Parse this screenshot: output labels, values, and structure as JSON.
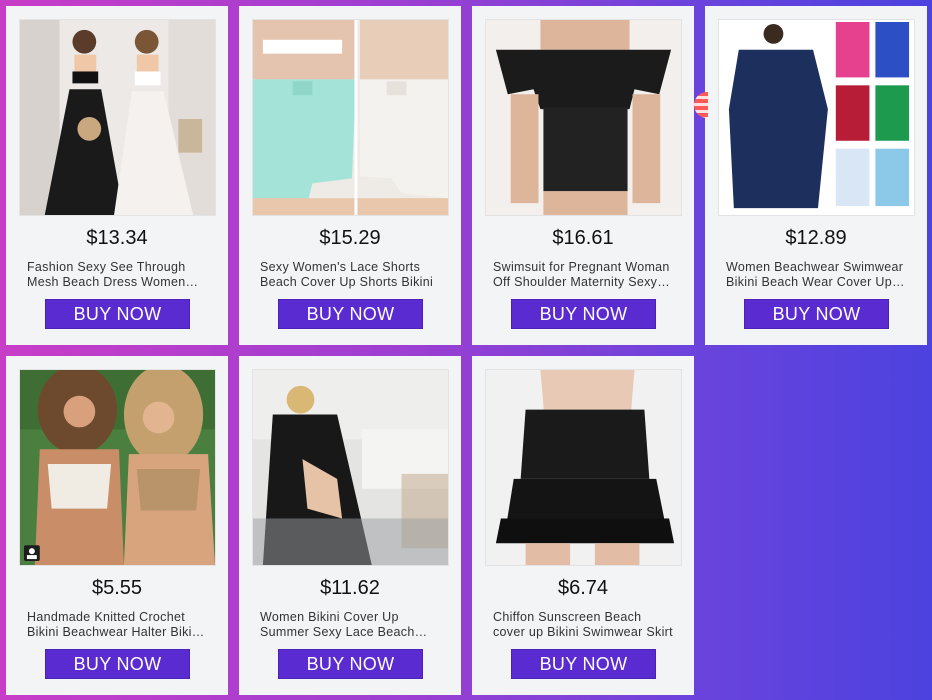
{
  "products": [
    {
      "price": "$13.34",
      "title": "Fashion Sexy See Through Mesh Beach Dress Women Cover Up",
      "buy_label": "BUY NOW"
    },
    {
      "price": "$15.29",
      "title": "Sexy Women's Lace Shorts Beach Cover Up Shorts Bikini",
      "buy_label": "BUY NOW"
    },
    {
      "price": "$16.61",
      "title": "Swimsuit for Pregnant Woman Off Shoulder Maternity Sexy Swimwear",
      "buy_label": "BUY NOW"
    },
    {
      "price": "$12.89",
      "title": "Women Beachwear Swimwear Bikini Beach Wear Cover Up Tunic",
      "buy_label": "BUY NOW"
    },
    {
      "price": "$5.55",
      "title": "Handmade Knitted Crochet Bikini Beachwear Halter Bikini Top",
      "buy_label": "BUY NOW"
    },
    {
      "price": "$11.62",
      "title": "Women Bikini Cover Up Summer Sexy Lace Beach Kimono",
      "buy_label": "BUY NOW"
    },
    {
      "price": "$6.74",
      "title": "Chiffon Sunscreen Beach cover up Bikini Swimwear Skirt",
      "buy_label": "BUY NOW"
    }
  ],
  "colors": {
    "button": "#5b2bd2",
    "card": "#f3f4f6"
  },
  "icons": {
    "badge": "person-badge-icon"
  }
}
